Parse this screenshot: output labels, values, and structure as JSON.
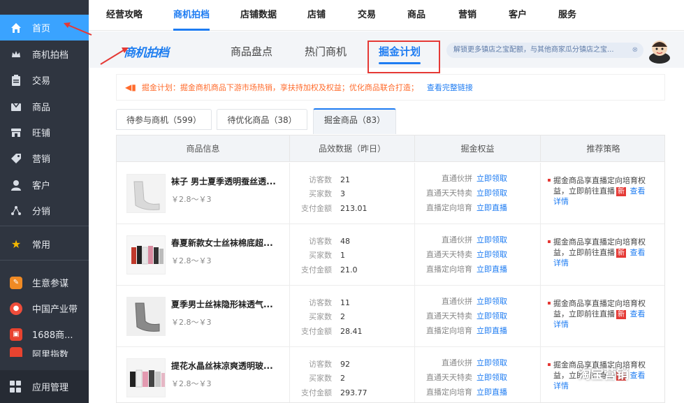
{
  "sidebar": {
    "items": [
      {
        "label": "首页",
        "icon": "home-icon"
      },
      {
        "label": "商机拍档",
        "icon": "crown-icon"
      },
      {
        "label": "交易",
        "icon": "clipboard-icon"
      },
      {
        "label": "商品",
        "icon": "box-icon"
      },
      {
        "label": "旺铺",
        "icon": "shop-icon"
      },
      {
        "label": "营销",
        "icon": "tag-icon"
      },
      {
        "label": "客户",
        "icon": "user-icon"
      },
      {
        "label": "分销",
        "icon": "share-icon"
      },
      {
        "label": "常用",
        "icon": "star-icon"
      },
      {
        "label": "生意参谋",
        "icon": "chart-app-icon"
      },
      {
        "label": "中国产业带",
        "icon": "location-app-icon"
      },
      {
        "label": "1688商...",
        "icon": "app-1688-icon"
      },
      {
        "label": "阿里指数",
        "icon": "app-index-icon"
      }
    ],
    "bottom": {
      "label": "应用管理",
      "icon": "grid-icon"
    }
  },
  "topnav": {
    "tabs": [
      "经营攻略",
      "商机拍档",
      "店铺数据",
      "店铺",
      "交易",
      "商品",
      "营销",
      "客户",
      "服务"
    ]
  },
  "subhead": {
    "logo": "商机拍档",
    "tabs": [
      "商品盘点",
      "热门商机",
      "掘金计划"
    ],
    "promo": "解锁更多镇店之宝配额，与其他商家瓜分镇店之宝...",
    "promo_close": "⊗"
  },
  "notice": {
    "text": "掘金计划：掘金商机商品下游市场热销，享扶持加权及权益；优化商品联合打造；",
    "link": "查看完整链接"
  },
  "list_tabs": [
    "待参与商机（599）",
    "待优化商品（38）",
    "掘金商品（83）"
  ],
  "table": {
    "headers": [
      "商品信息",
      "品效数据（昨日）",
      "掘金权益",
      "推荐策略"
    ],
    "metric_labels": [
      "访客数",
      "买家数",
      "支付金额"
    ],
    "benefit_labels": [
      "直通伙拼",
      "直通天天特卖",
      "直播定向培育"
    ],
    "benefit_actions": [
      "立即领取",
      "立即领取",
      "立即直播"
    ],
    "strategy": {
      "text": "掘金商品享直播定向培育权益，立即前往直播",
      "tag": "新",
      "link": "查看详情"
    },
    "rows": [
      {
        "name": "袜子 男士夏季透明蚕丝透...",
        "price": "￥2.8～￥3",
        "visitors": "21",
        "buyers": "3",
        "amount": "213.01"
      },
      {
        "name": "春夏新款女士丝袜棉底超...",
        "price": "￥2.8～￥3",
        "visitors": "48",
        "buyers": "1",
        "amount": "21.0"
      },
      {
        "name": "夏季男士丝袜隐形袜透气...",
        "price": "￥2.8～￥3",
        "visitors": "11",
        "buyers": "2",
        "amount": "28.41"
      },
      {
        "name": "提花水晶丝袜凉爽透明玻...",
        "price": "￥2.8～￥3",
        "visitors": "92",
        "buyers": "2",
        "amount": "293.77"
      }
    ]
  },
  "watermark": "淘宝营销",
  "colors": {
    "sidebar": "#2f3540",
    "accent": "#1e7cf2",
    "active_sidebar": "#3aa3ff",
    "alert": "#e53935",
    "notice": "#ff6b2c"
  }
}
